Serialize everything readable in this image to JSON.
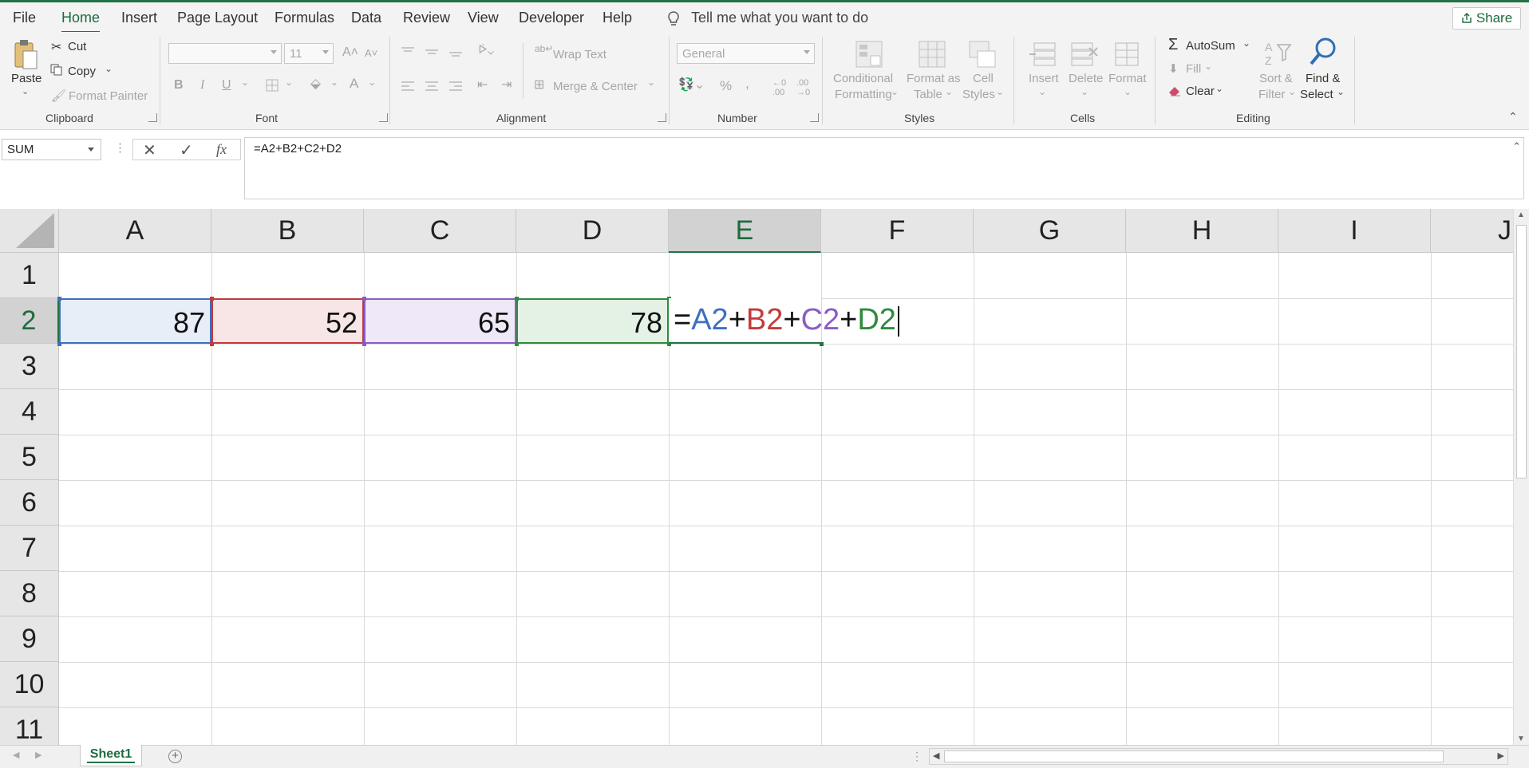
{
  "menu": {
    "tabs": [
      "File",
      "Home",
      "Insert",
      "Page Layout",
      "Formulas",
      "Data",
      "Review",
      "View",
      "Developer",
      "Help"
    ],
    "active": "Home",
    "tell_me": "Tell me what you want to do",
    "share": "Share"
  },
  "ribbon": {
    "clipboard": {
      "paste": "Paste",
      "cut": "Cut",
      "copy": "Copy",
      "format_painter": "Format Painter",
      "label": "Clipboard"
    },
    "font": {
      "size": "11",
      "label": "Font"
    },
    "alignment": {
      "wrap_text": "Wrap Text",
      "merge_center": "Merge & Center",
      "label": "Alignment"
    },
    "number": {
      "format": "General",
      "label": "Number"
    },
    "styles": {
      "conditional": "Conditional",
      "conditional2": "Formatting",
      "format_as": "Format as",
      "format_as2": "Table",
      "cell": "Cell",
      "cell2": "Styles",
      "label": "Styles"
    },
    "cells": {
      "insert": "Insert",
      "delete": "Delete",
      "format": "Format",
      "label": "Cells"
    },
    "editing": {
      "autosum": "AutoSum",
      "fill": "Fill",
      "clear": "Clear",
      "sort": "Sort &",
      "sort2": "Filter",
      "find": "Find &",
      "find2": "Select",
      "label": "Editing"
    }
  },
  "formula_bar": {
    "name_box": "SUM",
    "formula": "=A2+B2+C2+D2"
  },
  "grid": {
    "columns": [
      "A",
      "B",
      "C",
      "D",
      "E",
      "F",
      "G",
      "H",
      "I",
      "J"
    ],
    "rows": [
      "1",
      "2",
      "3",
      "4",
      "5",
      "6",
      "7",
      "8",
      "9",
      "10",
      "11"
    ],
    "selected_column": "E",
    "selected_row": "2",
    "cells": {
      "A2": "87",
      "B2": "52",
      "C2": "65",
      "D2": "78"
    },
    "edit": {
      "eq": "=",
      "r1": "A2",
      "p1": "+",
      "r2": "B2",
      "p2": "+",
      "r3": "C2",
      "p3": "+",
      "r4": "D2"
    }
  },
  "colors": {
    "ref_a": "#3e6fc2",
    "ref_b": "#c23b3b",
    "ref_c": "#8a5cc4",
    "ref_d": "#2e8b3e",
    "accent": "#217346"
  },
  "sheets": [
    "Sheet1"
  ]
}
